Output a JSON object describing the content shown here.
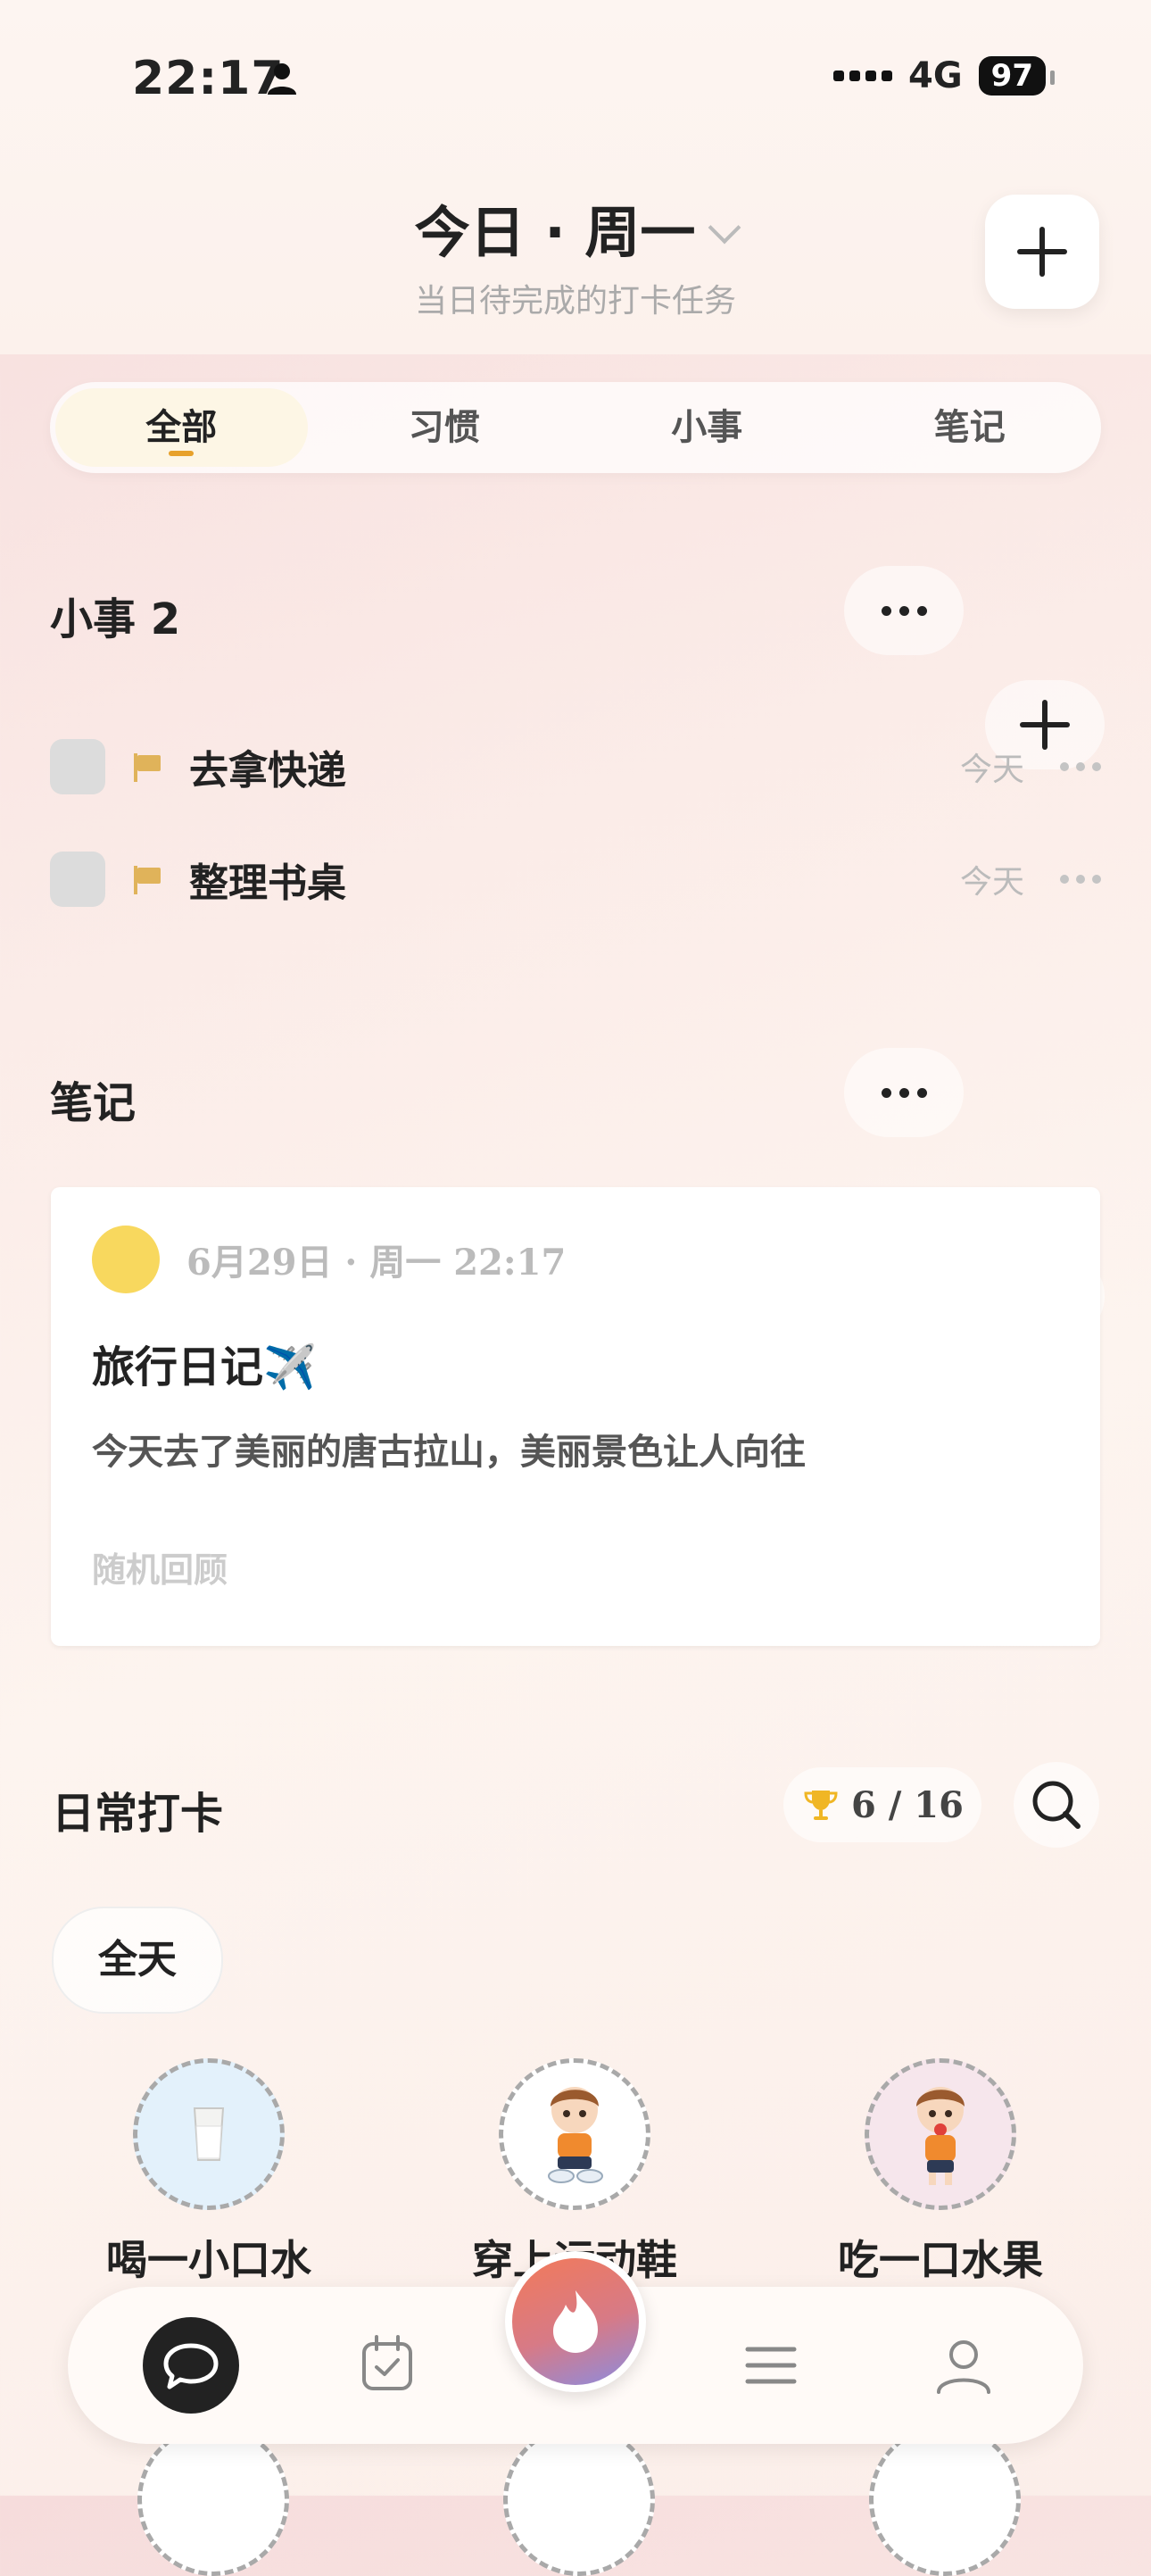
{
  "status_bar": {
    "time": "22:17",
    "network": "4G",
    "battery": "97"
  },
  "header": {
    "title": "今日 · 周一",
    "subtitle": "当日待完成的打卡任务"
  },
  "tabs": [
    {
      "label": "全部",
      "active": true
    },
    {
      "label": "习惯",
      "active": false
    },
    {
      "label": "小事",
      "active": false
    },
    {
      "label": "笔记",
      "active": false
    }
  ],
  "todos": {
    "title": "小事 2",
    "items": [
      {
        "text": "去拿快递",
        "date": "今天"
      },
      {
        "text": "整理书桌",
        "date": "今天"
      }
    ]
  },
  "notes": {
    "title": "笔记",
    "card": {
      "date": "6月29日 · 周一 22:17",
      "title": "旅行日记✈️",
      "body": "今天去了美丽的唐古拉山，美丽景色让人向往",
      "footer": "随机回顾"
    }
  },
  "daily": {
    "title": "日常打卡",
    "progress": "6 / 16",
    "filter": "全天",
    "habits": [
      {
        "label": "喝一小口水",
        "icon": "glass-of-water-icon",
        "bg": "#e3f1fb"
      },
      {
        "label": "穿上运动鞋",
        "icon": "boy-sneakers-icon",
        "bg": "#ffffff"
      },
      {
        "label": "吃一口水果",
        "icon": "boy-fruit-icon",
        "bg": "#f6e6ec"
      }
    ]
  },
  "colors": {
    "accent": "#e7a12b",
    "flag": "#e0b35a",
    "note_dot": "#f8d85e"
  }
}
